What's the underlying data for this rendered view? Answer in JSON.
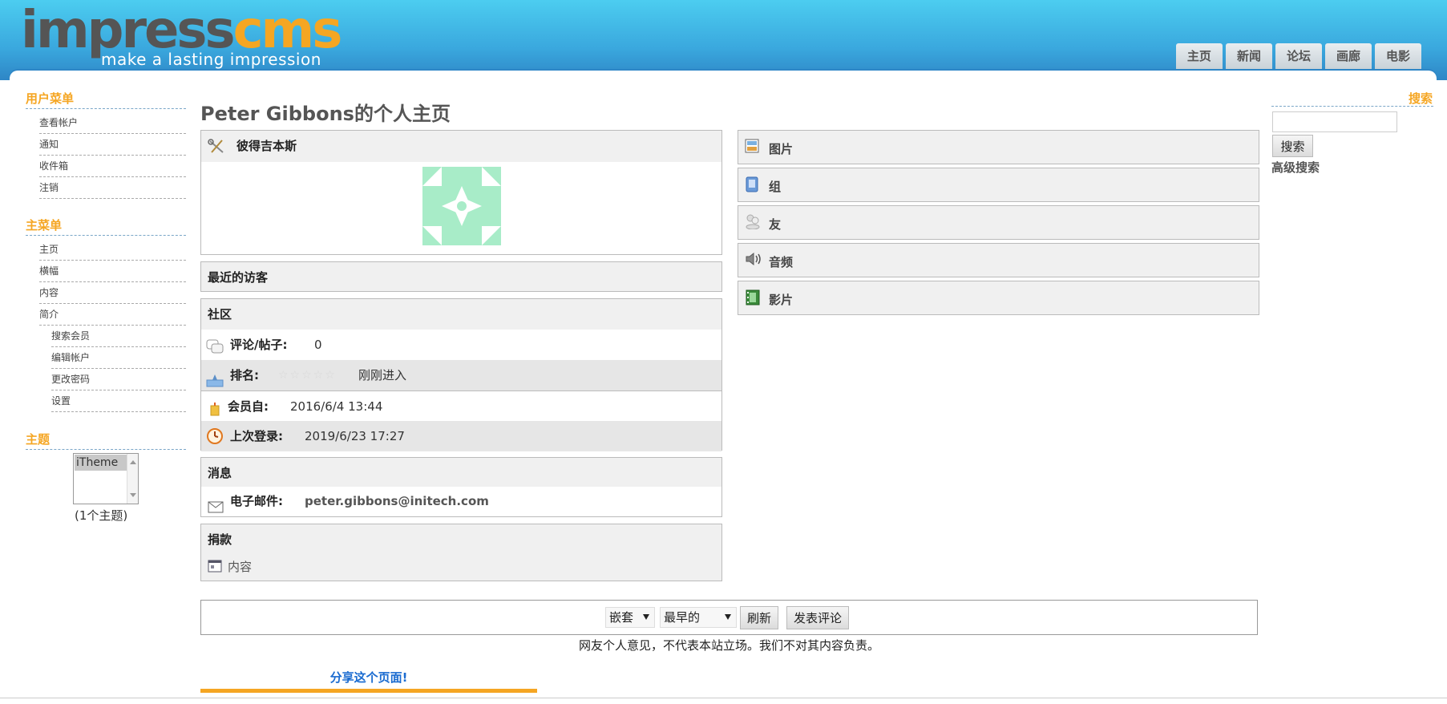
{
  "header": {
    "logo_main": "impress",
    "logo_accent": "cms",
    "logo_tagline": "make a lasting impression",
    "nav": [
      "主页",
      "新闻",
      "论坛",
      "画廊",
      "电影"
    ]
  },
  "sidebar": {
    "user_menu_title": "用户菜单",
    "user_menu": [
      "查看帐户",
      "通知",
      "收件箱",
      "注销"
    ],
    "main_menu_title": "主菜单",
    "main_menu": [
      "主页",
      "横幅",
      "内容",
      "简介"
    ],
    "profile_submenu": [
      "搜索会员",
      "编辑帐户",
      "更改密码",
      "设置"
    ],
    "theme_title": "主题",
    "theme_selected": "iTheme",
    "theme_count": "(1个主题)"
  },
  "main": {
    "page_title": "Peter Gibbons的个人主页",
    "user_box": {
      "name": "彼得吉本斯"
    },
    "recent_visitors": "最近的访客",
    "community": {
      "title": "社区",
      "comments_label": "评论/帖子:",
      "comments_value": "0",
      "rank_label": "排名:",
      "rank_value": "刚刚进入",
      "member_since_label": "会员自:",
      "member_since_value": "2016/6/4 13:44",
      "last_login_label": "上次登录:",
      "last_login_value": "2019/6/23 17:27"
    },
    "messages": {
      "title": "消息",
      "email_label": "电子邮件:",
      "email_value": "peter.gibbons@initech.com"
    },
    "donations": {
      "title": "捐款",
      "content_label": "内容"
    },
    "right_boxes": [
      "图片",
      "组",
      "友",
      "音频",
      "影片"
    ]
  },
  "search": {
    "title": "搜索",
    "input_value": "",
    "button": "搜索",
    "advanced": "高级搜索"
  },
  "comments": {
    "mode": "嵌套",
    "order": "最早的",
    "refresh": "刷新",
    "post": "发表评论",
    "disclaimer": "网友个人意见，不代表本站立场。我们不对其内容负责。"
  },
  "share": "分享这个页面!",
  "colors": {
    "accent": "#f5a623",
    "header_top": "#4ccdf0",
    "header_bottom": "#2e86c6",
    "link": "#1a6bd0"
  }
}
